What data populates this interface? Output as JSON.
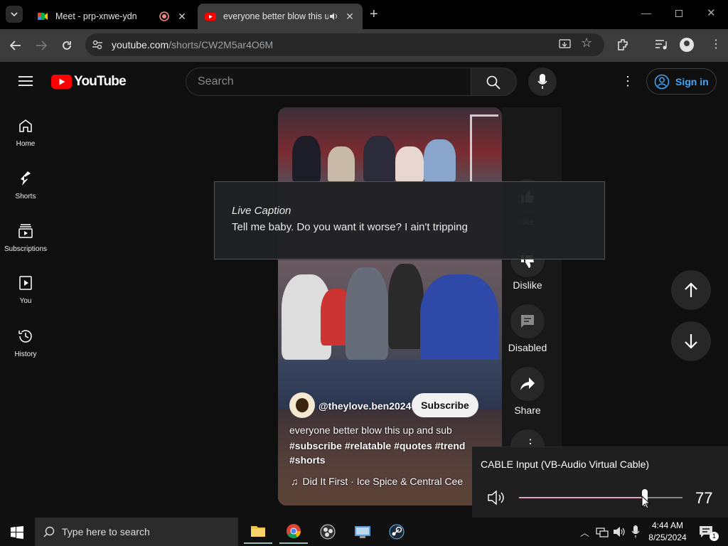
{
  "browser": {
    "tabs": [
      {
        "title": "Meet - prp-xnwe-ydn"
      },
      {
        "title": "everyone better blow this up"
      }
    ],
    "url_domain": "youtube.com",
    "url_path": "/shorts/CW2M5ar4O6M"
  },
  "youtube": {
    "logo_text": "YouTube",
    "search_placeholder": "Search",
    "signin_label": "Sign in",
    "sidebar": [
      {
        "label": "Home",
        "icon": "home-icon"
      },
      {
        "label": "Shorts",
        "icon": "shorts-icon"
      },
      {
        "label": "Subscriptions",
        "icon": "subscriptions-icon"
      },
      {
        "label": "You",
        "icon": "you-icon"
      },
      {
        "label": "History",
        "icon": "history-icon"
      }
    ],
    "short": {
      "channel": "@theylove.ben2024",
      "subscribe_label": "Subscribe",
      "description": "everyone better blow this up and sub",
      "hashtags": "#subscribe #relatable #quotes #trend #shorts",
      "music": "Did It First · Ice Spice & Central Cee"
    },
    "actions": {
      "like_label": "like",
      "dislike_label": "Dislike",
      "comments_label": "Disabled",
      "share_label": "Share"
    }
  },
  "live_caption": {
    "heading": "Live Caption",
    "text": "Tell me baby. Do you want it worse? I ain't tripping"
  },
  "volume_flyout": {
    "device": "CABLE Input (VB-Audio Virtual Cable)",
    "level": 77,
    "level_fraction": 0.77,
    "accent": "#e5a0c2"
  },
  "taskbar": {
    "search_placeholder": "Type here to search",
    "time": "4:44 AM",
    "date": "8/25/2024",
    "notification_count": "1"
  }
}
